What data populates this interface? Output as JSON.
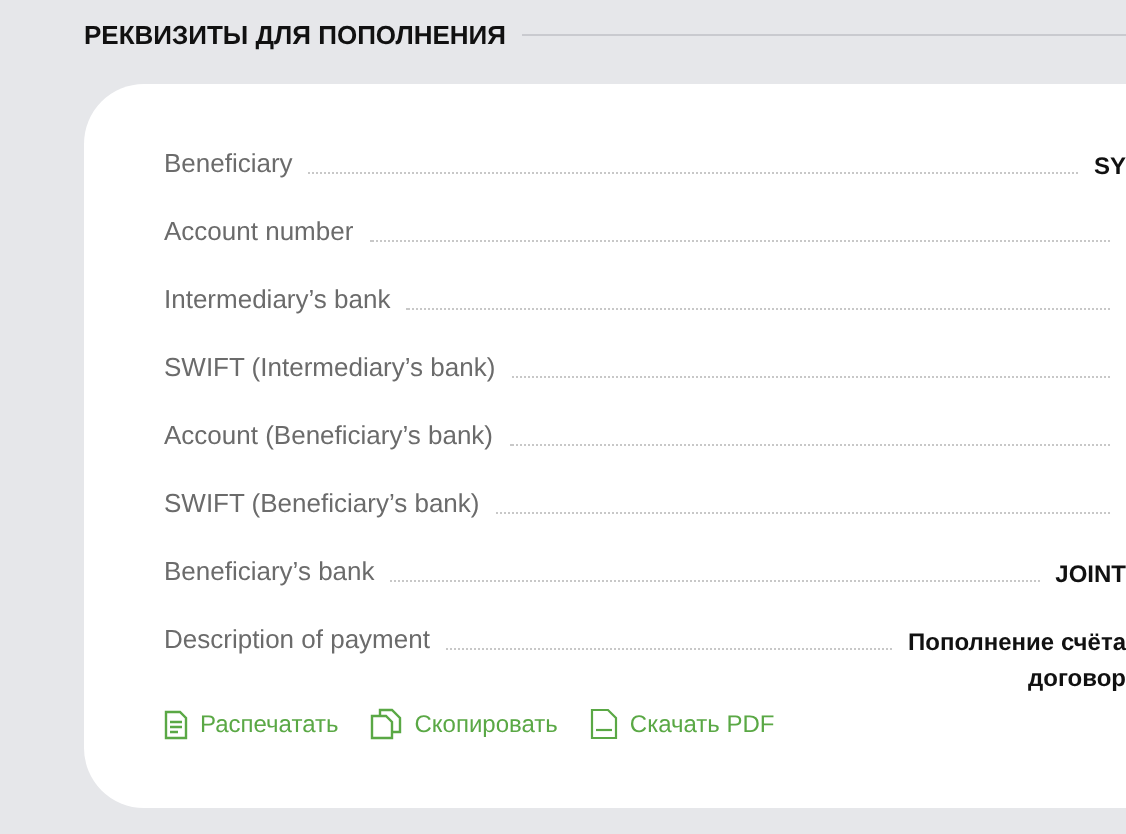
{
  "section": {
    "title": "РЕКВИЗИТЫ ДЛЯ ПОПОЛНЕНИЯ"
  },
  "rows": [
    {
      "label": "Beneficiary",
      "value": [
        "SY"
      ]
    },
    {
      "label": "Account number"
    },
    {
      "label": "Intermediary’s bank"
    },
    {
      "label": "SWIFT (Intermediary’s bank)"
    },
    {
      "label": "Account (Beneficiary’s bank)"
    },
    {
      "label": "SWIFT (Beneficiary’s bank)"
    },
    {
      "label": "Beneficiary’s bank",
      "value": [
        "JOINT"
      ]
    },
    {
      "label": "Description of payment",
      "value": [
        "Пополнение счёта",
        "договор"
      ]
    }
  ],
  "actions": [
    {
      "kind": "print",
      "label": "Распечатать"
    },
    {
      "kind": "copy",
      "label": "Скопировать"
    },
    {
      "kind": "pdf",
      "label": "Скачать PDF"
    }
  ]
}
